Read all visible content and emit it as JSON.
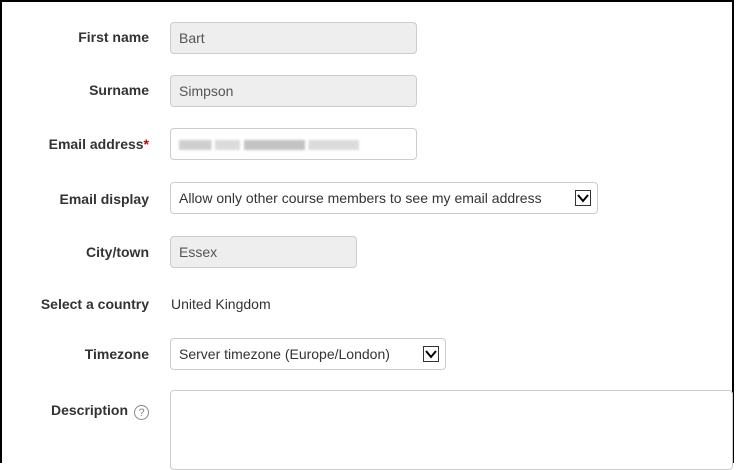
{
  "form": {
    "first_name": {
      "label": "First name",
      "value": "Bart"
    },
    "surname": {
      "label": "Surname",
      "value": "Simpson"
    },
    "email": {
      "label": "Email address",
      "required_marker": "*",
      "value": ""
    },
    "email_display": {
      "label": "Email display",
      "selected": "Allow only other course members to see my email address"
    },
    "city": {
      "label": "City/town",
      "value": "Essex"
    },
    "country": {
      "label": "Select a country",
      "value": "United Kingdom"
    },
    "timezone": {
      "label": "Timezone",
      "selected": "Server timezone (Europe/London)"
    },
    "description": {
      "label": "Description",
      "help_icon": "?",
      "value": ""
    }
  },
  "colors": {
    "required": "#cc0000",
    "readonly_bg": "#eeeeee",
    "border": "#cccccc"
  }
}
